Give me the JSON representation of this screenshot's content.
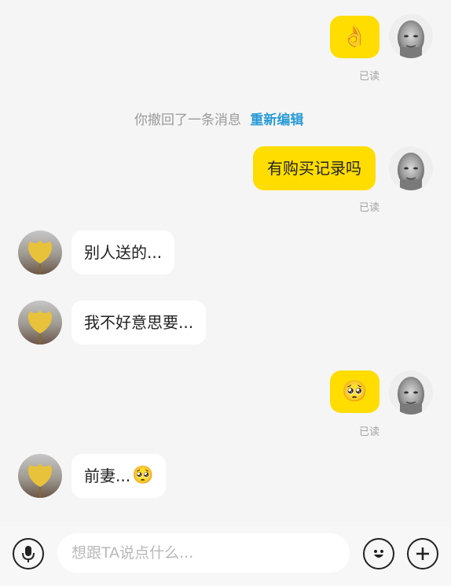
{
  "messages": {
    "m1_emoji": "👌",
    "m1_read": "已读",
    "recall_text": "你撤回了一条消息",
    "recall_action": "重新编辑",
    "m2_text": "有购买记录吗",
    "m2_read": "已读",
    "m3_text": "别人送的...",
    "m4_text": "我不好意思要...",
    "m5_emoji": "🥺",
    "m5_read": "已读",
    "m6_text": "前妻...",
    "m6_emoji": "🥺"
  },
  "input": {
    "placeholder": "想跟TA说点什么..."
  },
  "colors": {
    "my_bubble": "#ffdd00",
    "other_bubble": "#ffffff",
    "link": "#2a9bd6",
    "background": "#f5f5f5"
  },
  "icons": [
    "microphone-icon",
    "emoji-icon",
    "plus-icon"
  ]
}
